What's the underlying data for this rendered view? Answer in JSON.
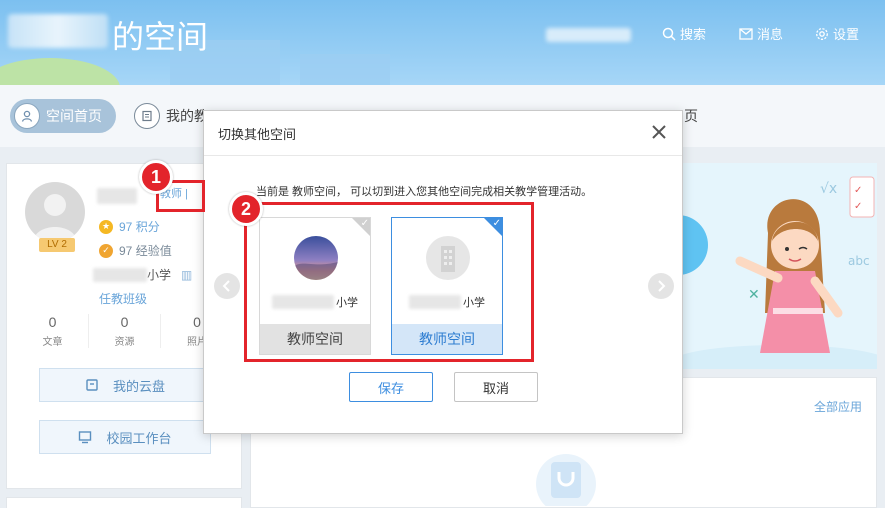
{
  "header": {
    "title": "的空间",
    "nav": [
      {
        "label": "搜索",
        "icon": "search-icon"
      },
      {
        "label": "消息",
        "icon": "mail-icon"
      },
      {
        "label": "设置",
        "icon": "gear-icon"
      }
    ]
  },
  "tabs": [
    {
      "label": "空间首页",
      "active": true
    },
    {
      "label": "我的教",
      "active": false
    },
    {
      "label": "页",
      "active": false
    }
  ],
  "profile": {
    "role": "教师 |",
    "level": "LV 2",
    "points_value": "97",
    "points_label": "积分",
    "exp_value": "97",
    "exp_label": "经验值",
    "school_suffix": "小学",
    "class_link": "任教班级",
    "counts": [
      {
        "value": "0",
        "label": "文章"
      },
      {
        "value": "0",
        "label": "资源"
      },
      {
        "value": "0",
        "label": "照片"
      }
    ],
    "buttons": [
      {
        "label": "我的云盘",
        "icon": "cloud-disk-icon"
      },
      {
        "label": "校园工作台",
        "icon": "workbench-icon"
      }
    ]
  },
  "apps": {
    "all_link": "全部应用"
  },
  "modal": {
    "title": "切换其他空间",
    "description": "当前是 教师空间， 可以切到进入您其他空间完成相关教学管理活动。",
    "spaces": [
      {
        "school_suffix": "小学",
        "label": "教师空间",
        "selected": false
      },
      {
        "school_suffix": "小学",
        "label": "教师空间",
        "selected": true
      }
    ],
    "save_label": "保存",
    "cancel_label": "取消"
  },
  "annotations": {
    "step1": "1",
    "step2": "2",
    "color": "#e3242b"
  },
  "colors": {
    "header_bg": "#8ec9f2",
    "accent": "#3d8ee0",
    "link": "#6aa5d9"
  }
}
